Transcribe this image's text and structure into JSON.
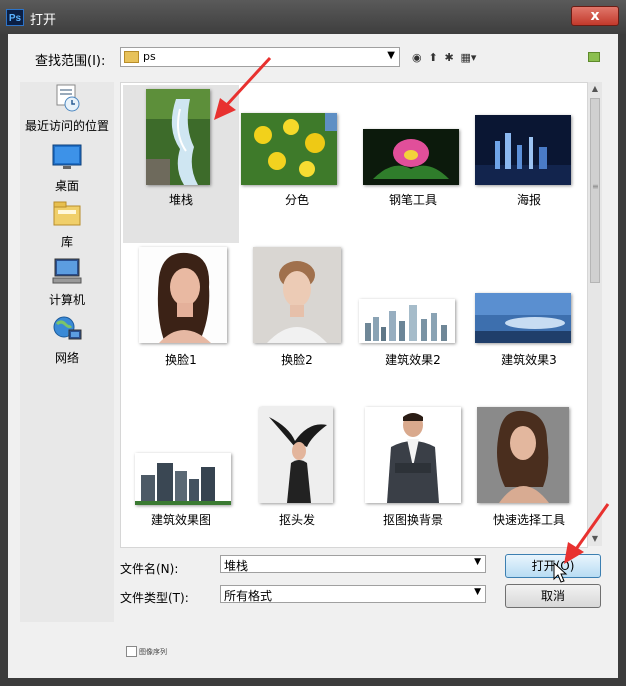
{
  "window": {
    "title": "打开",
    "app_icon": "Ps",
    "close_label": "x"
  },
  "lookin": {
    "label": "查找范围(I):",
    "value": "ps"
  },
  "places": [
    {
      "label": "最近访问的位置",
      "icon": "recent-icon"
    },
    {
      "label": "桌面",
      "icon": "desktop-icon"
    },
    {
      "label": "库",
      "icon": "library-icon"
    },
    {
      "label": "计算机",
      "icon": "computer-icon"
    },
    {
      "label": "网络",
      "icon": "network-icon"
    }
  ],
  "files": [
    {
      "name": "堆栈",
      "selected": true
    },
    {
      "name": "分色"
    },
    {
      "name": "钢笔工具"
    },
    {
      "name": "海报"
    },
    {
      "name": "换脸1"
    },
    {
      "name": "换脸2"
    },
    {
      "name": "建筑效果2"
    },
    {
      "name": "建筑效果3"
    },
    {
      "name": "建筑效果图"
    },
    {
      "name": "抠头发"
    },
    {
      "name": "抠图换背景"
    },
    {
      "name": "快速选择工具"
    }
  ],
  "filename": {
    "label": "文件名(N):",
    "value": "堆栈"
  },
  "filetype": {
    "label": "文件类型(T):",
    "value": "所有格式"
  },
  "buttons": {
    "open": "打开(O)",
    "cancel": "取消"
  },
  "sequence_checkbox": {
    "label": "图像序列",
    "checked": false
  },
  "colors": {
    "accent": "#3c7fb1",
    "annotation": "#e8312f"
  }
}
